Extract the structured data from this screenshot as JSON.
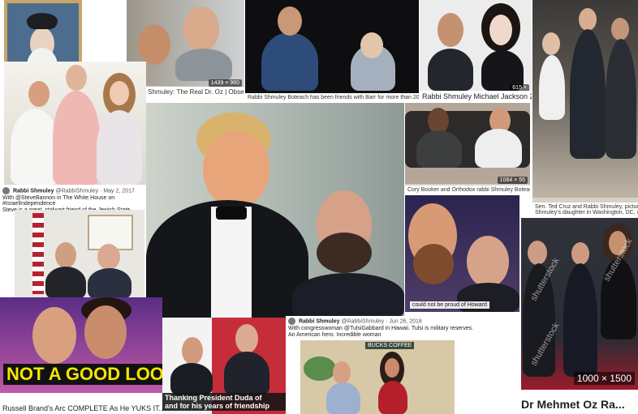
{
  "tiles": {
    "rebbe_portrait": {},
    "dr_oz": {
      "caption": "Rabbi Shmuley: The Real Dr. Oz | Observer",
      "dims": "1439 × 960"
    },
    "barr": {
      "caption": "Rabbi Shmuley Boteach has been friends with Barr for more than 20 years."
    },
    "michael_jackson": {
      "caption": "Rabbi Shmuley Michael Jackson 2001",
      "dims": "615 ×"
    },
    "ted_cruz": {
      "caption": "Sen. Ted Cruz and Rabbi Shmuley, pictured",
      "caption2": "Shmuley's daughter in Washington, DC, w"
    },
    "rfk": {},
    "bannon_tweet": {
      "name": "Rabbi Shmuley",
      "handle": "@RabbiShmuley · May 2, 2017",
      "text": "With @SteveBannon in The White House on #IsraelIndependence",
      "text2": "Steve is a great, stalwart friend of the Jewish State"
    },
    "bannon_photo": {},
    "trump": {},
    "booker": {
      "caption": "Cory Booker and Orthodox rabbi Shmuley Boteach",
      "dims": "1084 × 55"
    },
    "selfie_howard": {
      "overlay": "could not be proud of Howard"
    },
    "oz_shutterstock": {
      "dims": "1000 × 1500",
      "title": "Dr Mehmet Oz Ra...",
      "watermark": "shutterstock"
    },
    "russell_brand": {
      "banner": "NOT A GOOD LOOK",
      "caption": "Russell Brand's Arc COMPLETE As He YUKS IT..."
    },
    "duda": {
      "caption": "Thanking President Duda of",
      "caption2": "and for his years of friendship"
    },
    "gabbard_tweet": {
      "name": "Rabbi Shmuley",
      "handle": "@RabbiShmuley · Jun 26, 2018",
      "text": "With congresswoman @TulsiGabbard in Hawaii. Tulsi is military reserves.",
      "text2": "An American hero. Incredible woman"
    },
    "cafe": {
      "sign": "BUCKS COFFEE"
    }
  }
}
